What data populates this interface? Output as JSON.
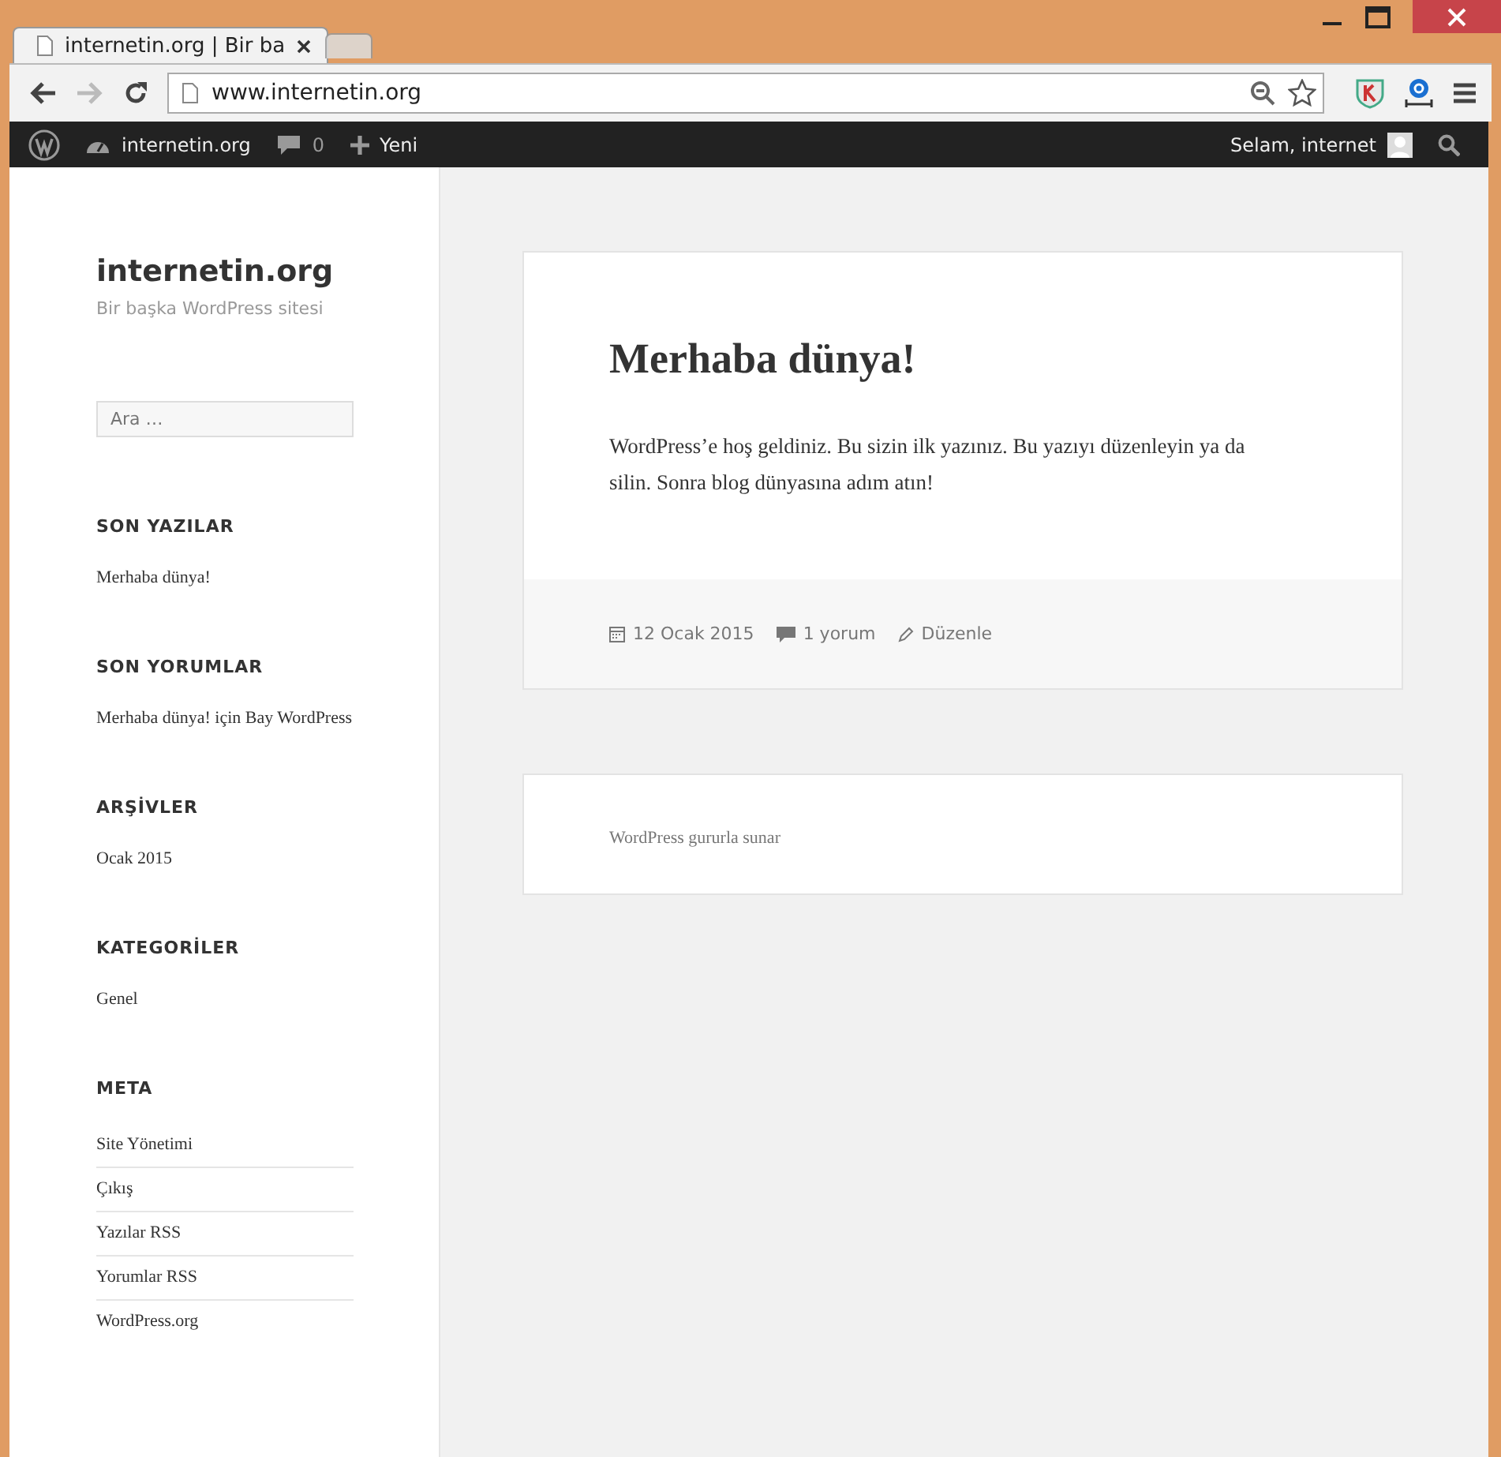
{
  "browser": {
    "tabs": [
      {
        "title": "internetin.org | Bir ba",
        "selected": true
      },
      {
        "selected": false
      }
    ],
    "url": "www.internetin.org"
  },
  "admin_bar": {
    "site": "internetin.org",
    "comments": "0",
    "new": "Yeni",
    "greeting": "Selam, internet"
  },
  "site": {
    "title": "internetin.org",
    "tagline": "Bir başka WordPress sitesi"
  },
  "search": {
    "placeholder": "Ara …"
  },
  "widgets": [
    {
      "title": "SON YAZILAR",
      "kind": "plain",
      "items": [
        "Merhaba dünya!"
      ]
    },
    {
      "title": "SON YORUMLAR",
      "kind": "plain",
      "items": [
        "Merhaba dünya! için Bay WordPress"
      ]
    },
    {
      "title": "ARŞİVLER",
      "kind": "plain",
      "items": [
        "Ocak 2015"
      ]
    },
    {
      "title": "KATEGORİLER",
      "kind": "plain",
      "items": [
        "Genel"
      ]
    },
    {
      "title": "META",
      "kind": "divided",
      "items": [
        "Site Yönetimi",
        "Çıkış",
        "Yazılar RSS",
        "Yorumlar RSS",
        "WordPress.org"
      ]
    }
  ],
  "post": {
    "title": "Merhaba dünya!",
    "body": "WordPress’e hoş geldiniz. Bu sizin ilk yazınız. Bu yazıyı düzenleyin ya da silin. Sonra blog dünyasına adım atın!",
    "date": "12 Ocak 2015",
    "comments": "1 yorum",
    "edit": "Düzenle"
  },
  "footer": {
    "text": "WordPress gururla sunar"
  }
}
